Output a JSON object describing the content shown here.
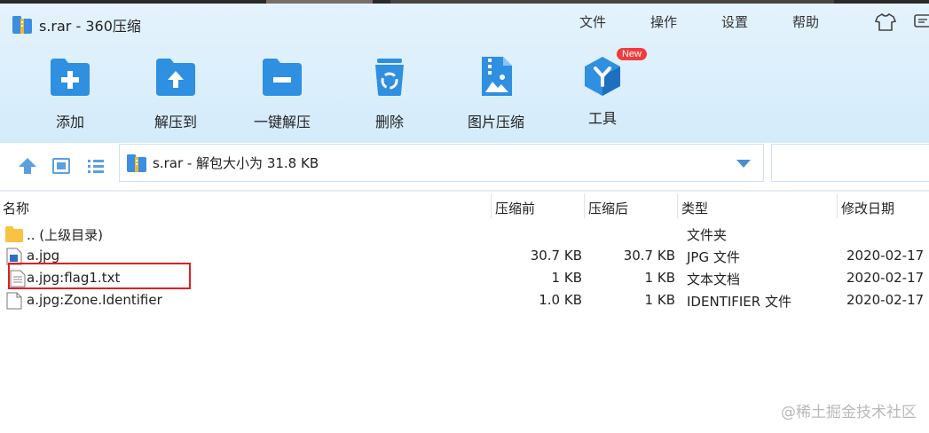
{
  "window": {
    "title": "s.rar - 360压缩"
  },
  "menu": [
    {
      "label": "文件"
    },
    {
      "label": "操作"
    },
    {
      "label": "设置"
    },
    {
      "label": "帮助"
    }
  ],
  "toolbar": [
    {
      "label": "添加",
      "icon": "add-folder-icon"
    },
    {
      "label": "解压到",
      "icon": "extract-to-icon"
    },
    {
      "label": "一键解压",
      "icon": "one-click-extract-icon"
    },
    {
      "label": "删除",
      "icon": "recycle-bin-icon"
    },
    {
      "label": "图片压缩",
      "icon": "image-compress-icon"
    },
    {
      "label": "工具",
      "icon": "tools-icon",
      "badge": "New"
    }
  ],
  "address": {
    "text": "s.rar - 解包大小为 31.8 KB"
  },
  "columns": {
    "name": "名称",
    "packed": "压缩前",
    "unpacked": "压缩后",
    "type": "类型",
    "modified": "修改日期"
  },
  "files": [
    {
      "name": ".. (上级目录)",
      "packed": "",
      "unpacked": "",
      "type": "文件夹",
      "modified": "",
      "icon": "folder-icon"
    },
    {
      "name": "a.jpg",
      "packed": "30.7 KB",
      "unpacked": "30.7 KB",
      "type": "JPG 文件",
      "modified": "2020-02-17",
      "icon": "image-file-icon"
    },
    {
      "name": "a.jpg:flag1.txt",
      "packed": "1 KB",
      "unpacked": "1 KB",
      "type": "文本文档",
      "modified": "2020-02-17",
      "icon": "text-file-icon"
    },
    {
      "name": "a.jpg:Zone.Identifier",
      "packed": "1.0 KB",
      "unpacked": "1 KB",
      "type": "IDENTIFIER 文件",
      "modified": "2020-02-17",
      "icon": "blank-file-icon"
    }
  ],
  "watermark": "@稀土掘金技术社区",
  "colors": {
    "accent": "#2f8fe0",
    "header_bg": "#dceffc",
    "highlight": "#e02020",
    "badge": "#f03c3c"
  }
}
